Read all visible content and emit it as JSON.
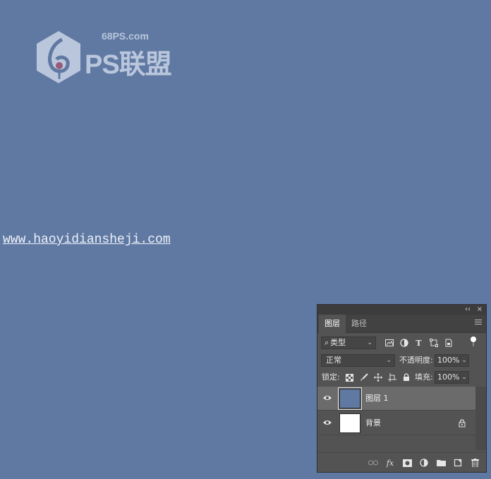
{
  "logo": {
    "domain": "68PS.com",
    "text": "PS联盟",
    "colors": {
      "mark": "#b9c6dc",
      "dot": "#9c5a78"
    }
  },
  "watermark": {
    "url": "www.haoyidiansheji.com"
  },
  "panel": {
    "topbar": {
      "collapse_icon": "double-chevron-left-icon",
      "close_icon": "close-icon",
      "collapse_label": "‹‹",
      "close_label": "×"
    },
    "tabs": [
      {
        "label": "图层",
        "active": true
      },
      {
        "label": "路径",
        "active": false
      }
    ],
    "filter": {
      "selected": "类型",
      "icons": [
        "image-filter-icon",
        "adjustment-filter-icon",
        "type-filter-icon",
        "shape-filter-icon",
        "smart-object-filter-icon"
      ],
      "type_glyph": "T"
    },
    "blend": {
      "mode": "正常",
      "opacity_label": "不透明度:",
      "opacity_value": "100%"
    },
    "lock": {
      "label": "锁定:",
      "icons": [
        "lock-transparent-icon",
        "lock-paint-icon",
        "lock-position-icon",
        "lock-artboard-icon",
        "lock-all-icon"
      ],
      "fill_label": "填充:",
      "fill_value": "100%"
    },
    "layers": [
      {
        "name": "图层 1",
        "thumb_color": "#6079a2",
        "selected": true,
        "locked": false
      },
      {
        "name": "背景",
        "thumb_color": "#ffffff",
        "selected": false,
        "locked": true
      }
    ],
    "bottom_icons": [
      "link-layers-icon",
      "fx-icon",
      "add-mask-icon",
      "adjustment-layer-icon",
      "new-group-icon",
      "new-layer-icon",
      "delete-icon"
    ],
    "fx_label": "fx"
  }
}
